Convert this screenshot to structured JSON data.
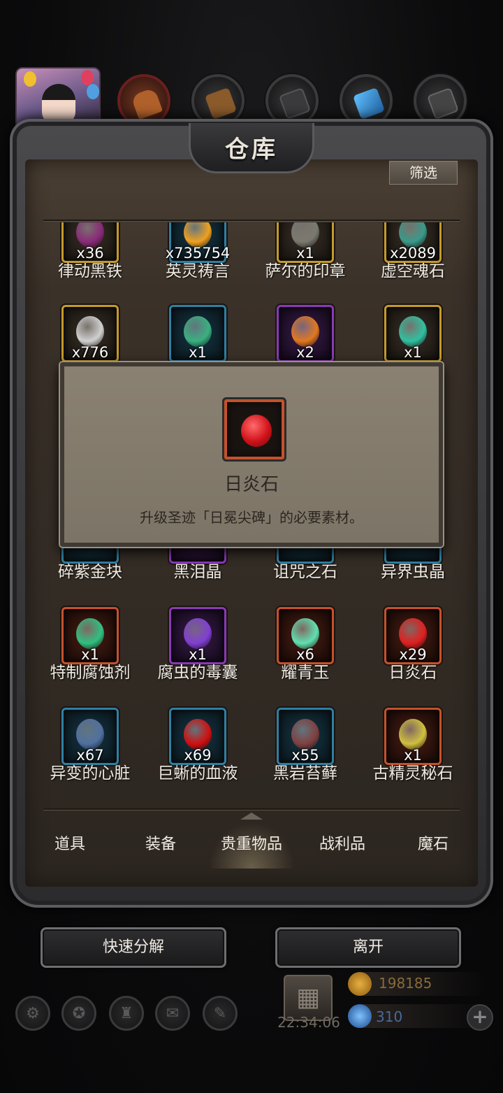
{
  "title": "仓库",
  "filter_label": "筛选",
  "category_icons": [
    "boots-icon",
    "wood-icon",
    "ore-icon",
    "crystal-icon",
    "scroll-icon"
  ],
  "items": [
    {
      "name": "律动黑铁",
      "qty": "x36",
      "rarity": "gold",
      "icon": "black-iron-icon",
      "color": "#8a2a7a"
    },
    {
      "name": "英灵祷言",
      "qty": "x735754",
      "rarity": "blue",
      "icon": "prayer-orb-icon",
      "color": "#f0a020"
    },
    {
      "name": "萨尔的印章",
      "qty": "x1",
      "rarity": "gold",
      "icon": "seal-icon",
      "color": "#7a7a70"
    },
    {
      "name": "虚空魂石",
      "qty": "x2089",
      "rarity": "gold",
      "icon": "void-soul-stone-icon",
      "color": "#3a9a8a"
    },
    {
      "name": "",
      "qty": "x776",
      "rarity": "gold",
      "icon": "crystal-cluster-icon",
      "color": "#d0d0d0"
    },
    {
      "name": "",
      "qty": "x1",
      "rarity": "blue",
      "icon": "green-sparkle-icon",
      "color": "#3ab080"
    },
    {
      "name": "",
      "qty": "x2",
      "rarity": "purple",
      "icon": "orange-shard-icon",
      "color": "#e07820"
    },
    {
      "name": "",
      "qty": "x1",
      "rarity": "gold",
      "icon": "teal-crystal-icon",
      "color": "#30c0a0"
    },
    {
      "name": "碎紫金块",
      "qty": "",
      "rarity": "blue",
      "icon": "purple-gold-icon",
      "color": "#7a4ab0"
    },
    {
      "name": "黑泪晶",
      "qty": "",
      "rarity": "purple",
      "icon": "black-tear-icon",
      "color": "#503060"
    },
    {
      "name": "诅咒之石",
      "qty": "",
      "rarity": "blue",
      "icon": "curse-stone-icon",
      "color": "#505060"
    },
    {
      "name": "异界虫晶",
      "qty": "",
      "rarity": "blue",
      "icon": "bug-crystal-icon",
      "color": "#405070"
    },
    {
      "name": "特制腐蚀剂",
      "qty": "x1",
      "rarity": "orange",
      "icon": "potion-icon",
      "color": "#30c080"
    },
    {
      "name": "腐虫的毒囊",
      "qty": "x1",
      "rarity": "purple",
      "icon": "poison-sac-icon",
      "color": "#8040d0"
    },
    {
      "name": "耀青玉",
      "qty": "x6",
      "rarity": "orange",
      "icon": "jade-crystal-icon",
      "color": "#60e0b0"
    },
    {
      "name": "日炎石",
      "qty": "x29",
      "rarity": "orange",
      "icon": "fire-stone-icon",
      "color": "#e02020"
    },
    {
      "name": "异变的心脏",
      "qty": "x67",
      "rarity": "blue",
      "icon": "heart-icon",
      "color": "#5070a0"
    },
    {
      "name": "巨蜥的血液",
      "qty": "x69",
      "rarity": "blue",
      "icon": "blood-drop-icon",
      "color": "#d01010"
    },
    {
      "name": "黑岩苔藓",
      "qty": "x55",
      "rarity": "blue",
      "icon": "moss-icon",
      "color": "#804040"
    },
    {
      "name": "古精灵秘石",
      "qty": "x1",
      "rarity": "orange",
      "icon": "elf-stone-icon",
      "color": "#d0c040"
    }
  ],
  "tooltip": {
    "name": "日炎石",
    "description": "升级圣迹「日冕尖碑」的必要素材。",
    "icon": "fire-stone-icon"
  },
  "tabs": [
    {
      "label": "道具",
      "active": false
    },
    {
      "label": "装备",
      "active": false
    },
    {
      "label": "贵重物品",
      "active": true
    },
    {
      "label": "战利品",
      "active": false
    },
    {
      "label": "魔石",
      "active": false
    }
  ],
  "buttons": {
    "decompose": "快速分解",
    "leave": "离开"
  },
  "footer": {
    "timer": "22:34:06",
    "gold": "198185",
    "gems": "310",
    "menu_icons": [
      "settings-icon",
      "badge-icon",
      "tower-icon",
      "mail-icon",
      "scroll-icon"
    ]
  },
  "colors": {
    "panel": "#3a3129",
    "gold_border": "#c49a2a",
    "blue_border": "#2f7fa2",
    "purple_border": "#8a39b6",
    "orange_border": "#c5512b",
    "tooltip_bg": "#847b6c"
  }
}
